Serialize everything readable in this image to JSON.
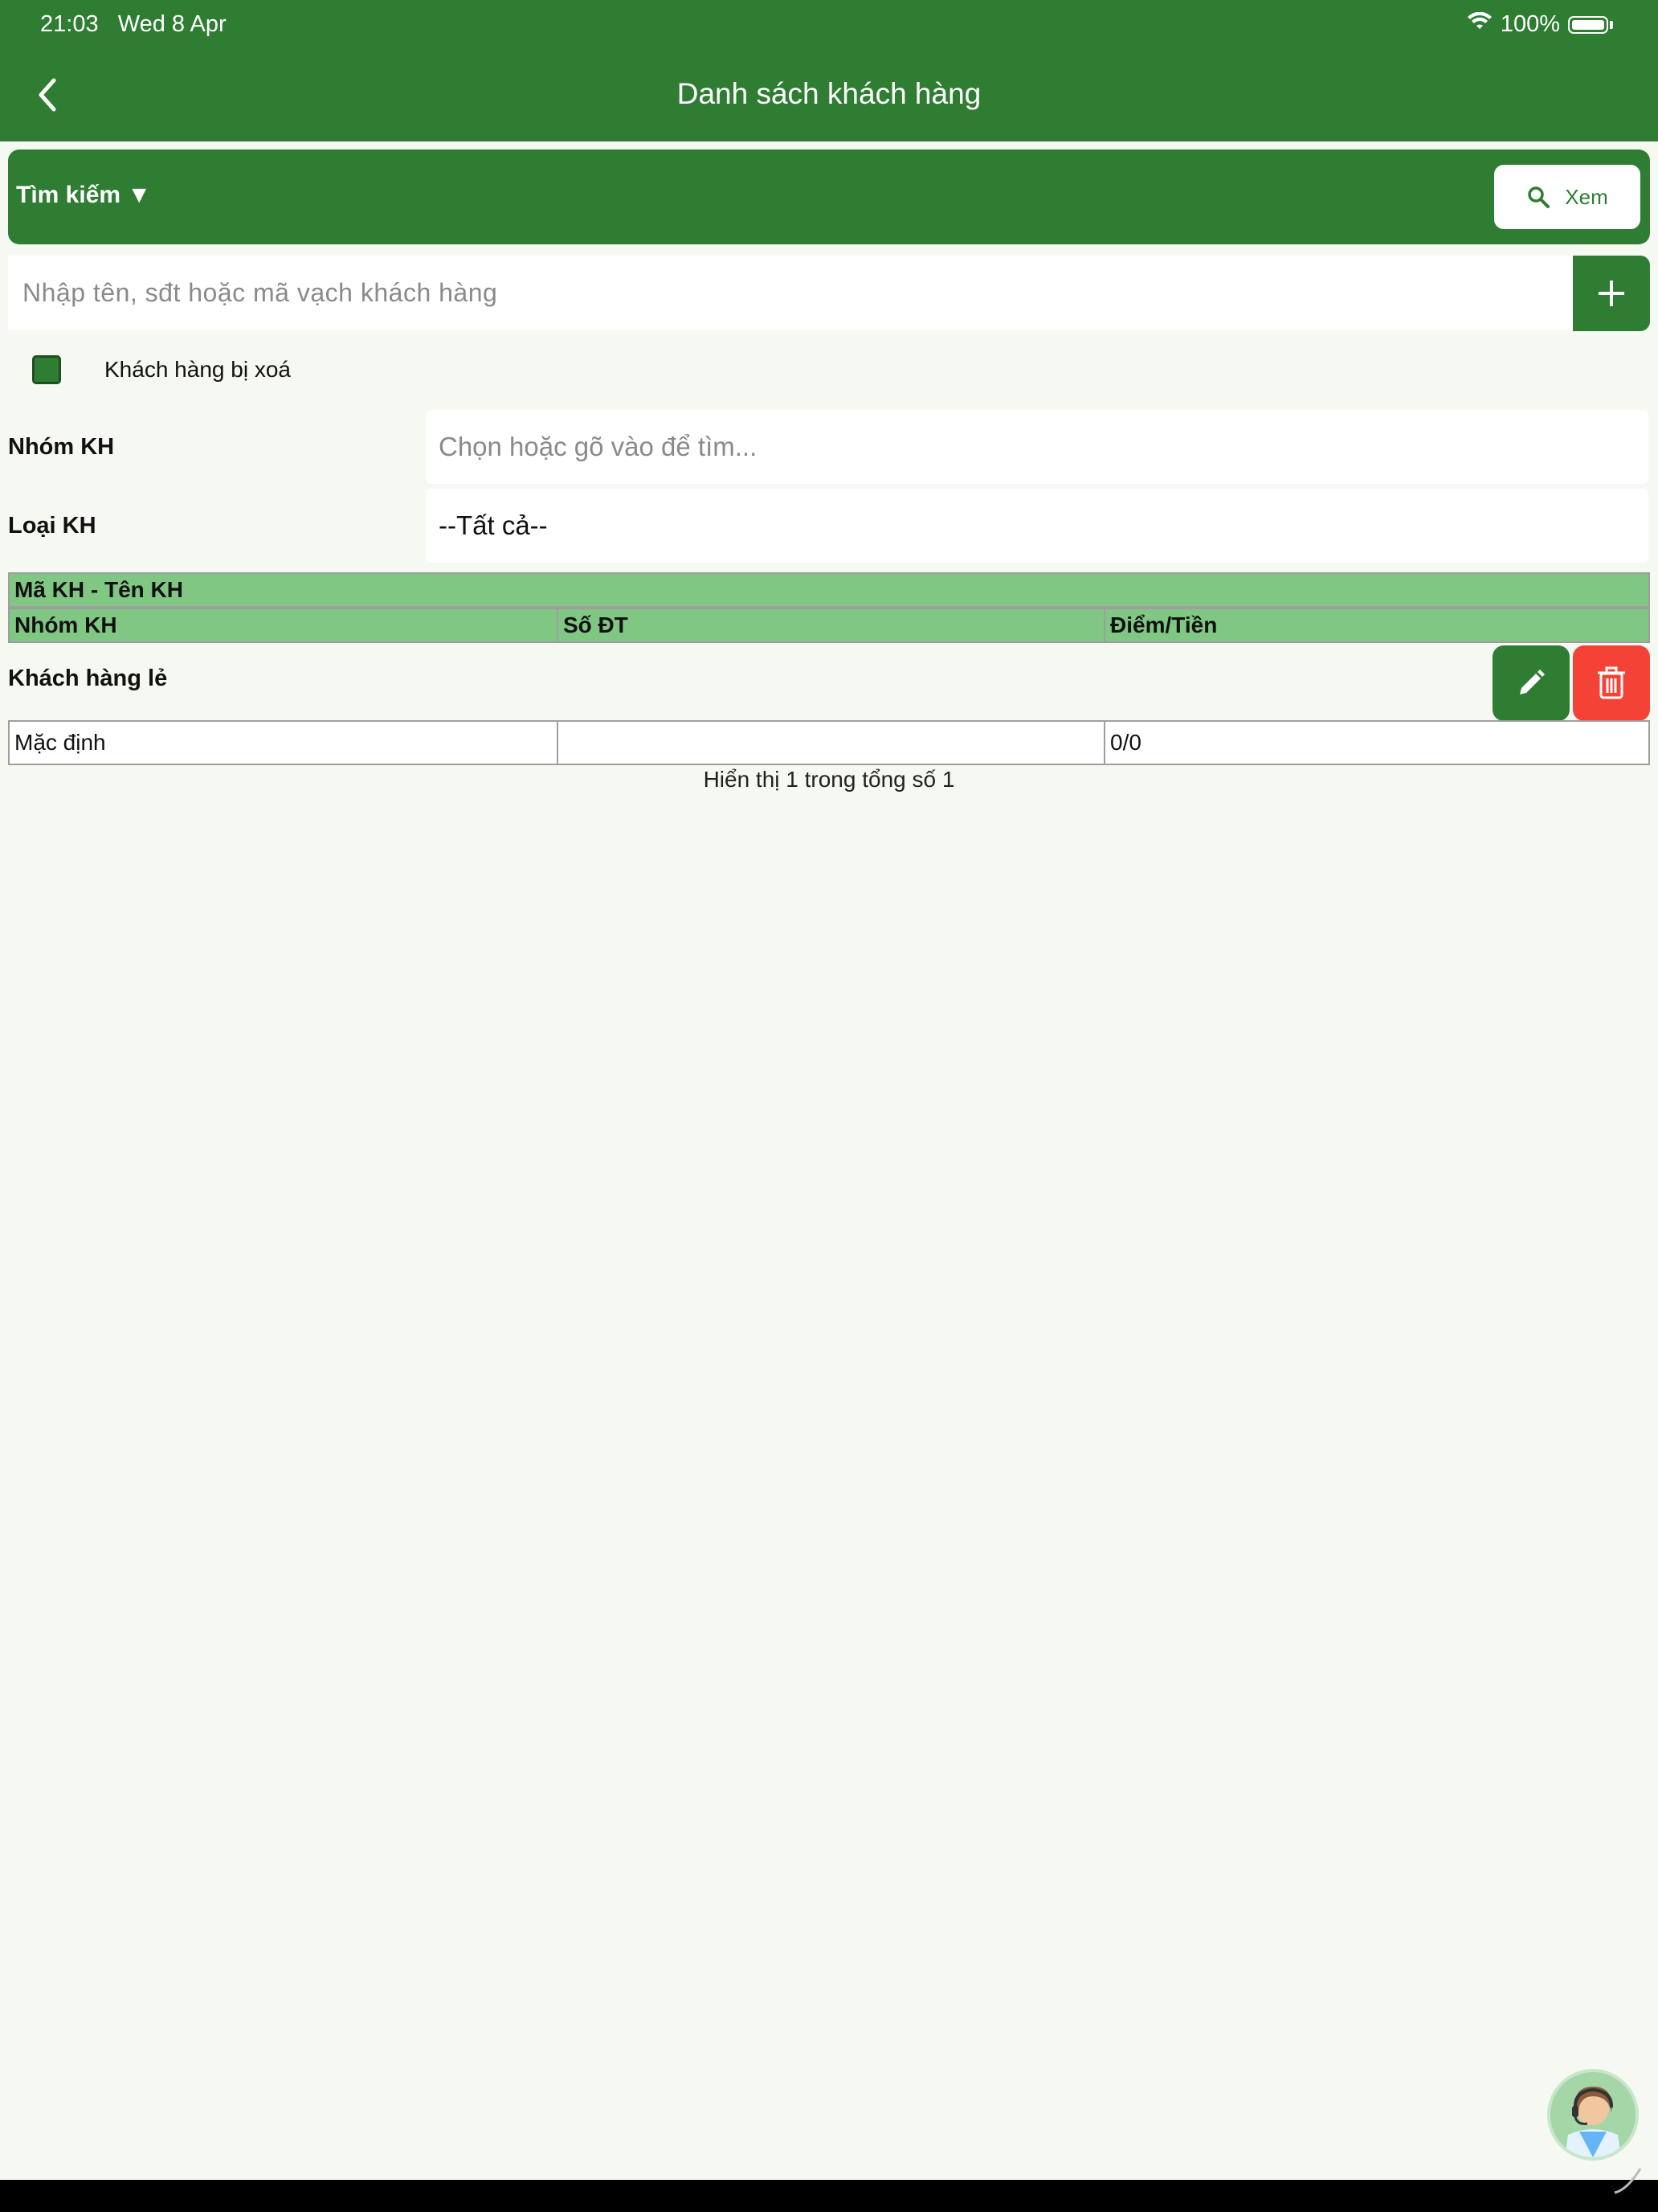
{
  "status_bar": {
    "time": "21:03",
    "date": "Wed 8 Apr",
    "battery": "100%"
  },
  "header": {
    "title": "Danh sách khách hàng"
  },
  "search": {
    "toggle_label": "Tìm kiếm ▼",
    "view_button": "Xem",
    "input_placeholder": "Nhập tên, sđt hoặc mã vạch khách hàng"
  },
  "filters": {
    "deleted_checkbox_label": "Khách hàng bị xoá",
    "group_label": "Nhóm KH",
    "group_placeholder": "Chọn hoặc gõ vào để tìm...",
    "type_label": "Loại KH",
    "type_value": "--Tất cả--"
  },
  "table": {
    "header_row1": "Mã KH - Tên KH",
    "header_row2": [
      "Nhóm KH",
      "Số ĐT",
      "Điểm/Tiền"
    ],
    "rows": [
      {
        "name": "Khách hàng lẻ",
        "group": "Mặc định",
        "phone": "",
        "points": "0/0"
      }
    ],
    "summary": "Hiển thị 1 trong tổng số 1"
  },
  "colors": {
    "primary": "#2e7d32",
    "header_cell": "#81c784",
    "danger": "#f44336",
    "background": "#f6f9f1"
  },
  "icons": {
    "back": "chevron-left-icon",
    "search": "search-icon",
    "add": "plus-icon",
    "edit": "pencil-icon",
    "delete": "trash-icon",
    "support": "support-agent-icon"
  }
}
